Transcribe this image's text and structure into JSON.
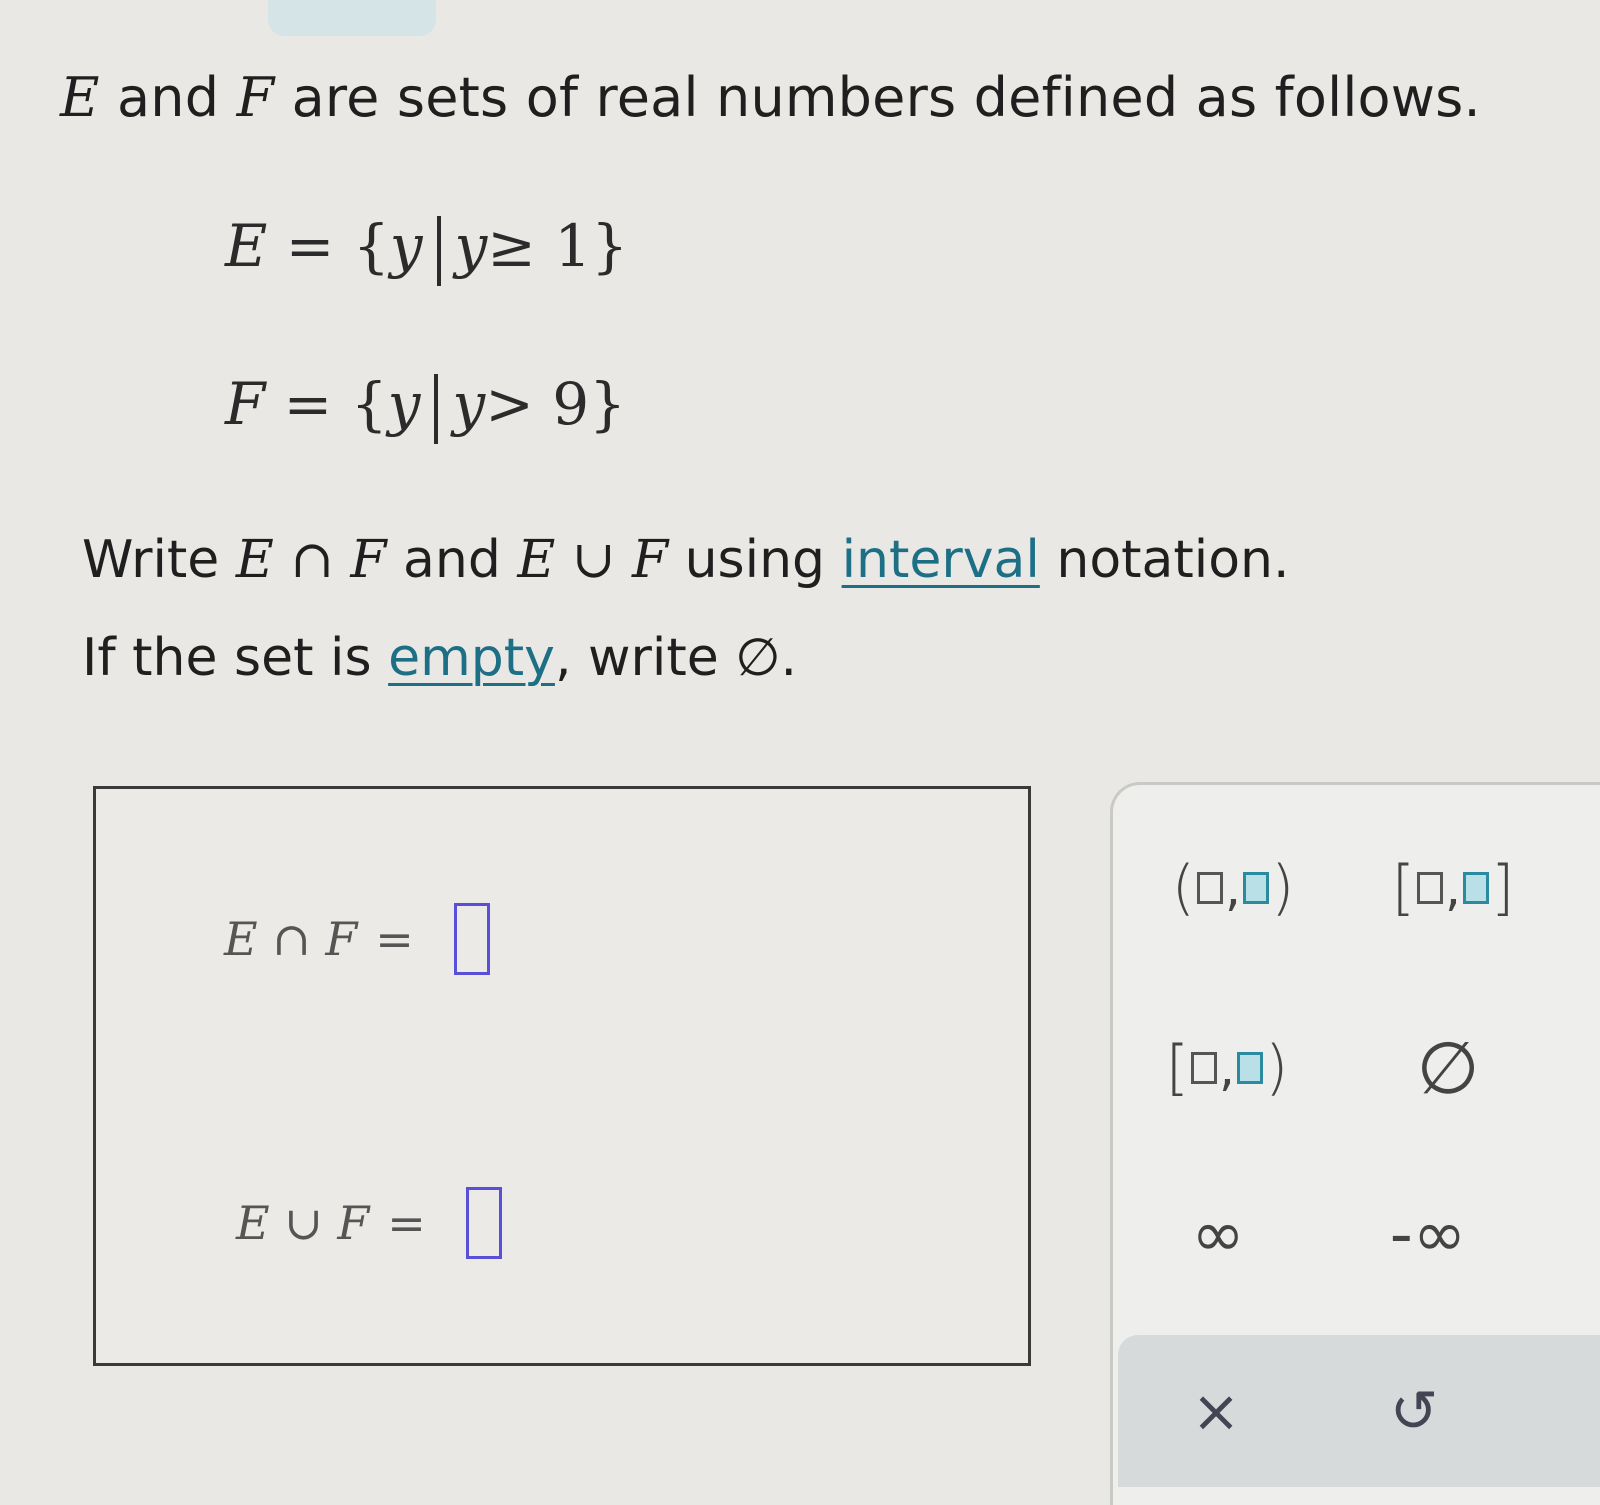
{
  "intro": {
    "setE": "E",
    "and": " and ",
    "setF": "F",
    "rest": " are sets of real numbers defined as follows."
  },
  "definitions": {
    "E": {
      "lhs": "E",
      "eq": " = {",
      "var": "y",
      "cond_var": "y",
      "cond_rel": "≥ 1",
      "close": "}"
    },
    "F": {
      "lhs": "F",
      "eq": " = {",
      "var": "y",
      "cond_var": "y",
      "cond_rel": "> 9",
      "close": "}"
    }
  },
  "instruction": {
    "line1_prefix": "Write ",
    "intersection_expr": "E ∩ F",
    "and": " and ",
    "union_expr": "E ∪ F",
    "using": " using ",
    "link_interval": "interval",
    "suffix": " notation.",
    "line2_prefix": "If the set is ",
    "link_empty": "empty",
    "line2_suffix": ", write ∅."
  },
  "answers": {
    "intersection_label": "E ∩ F",
    "union_label": "E ∪ F",
    "equals": "="
  },
  "keypad": {
    "open_paren": "(",
    "close_paren": ")",
    "open_bracket": "[",
    "close_bracket": "]",
    "comma": ",",
    "empty_set": "∅",
    "infinity": "∞",
    "neg_infinity": "-∞",
    "clear": "×",
    "undo": "↺"
  }
}
